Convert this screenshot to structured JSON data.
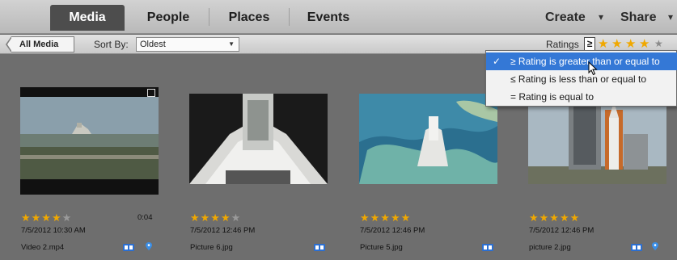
{
  "nav": {
    "tabs": [
      {
        "label": "Media",
        "active": true
      },
      {
        "label": "People",
        "active": false
      },
      {
        "label": "Places",
        "active": false
      },
      {
        "label": "Events",
        "active": false
      }
    ],
    "create_label": "Create",
    "share_label": "Share"
  },
  "toolbar": {
    "all_media_label": "All Media",
    "sort_by_label": "Sort By:",
    "sort_value": "Oldest",
    "ratings_label": "Ratings",
    "rating_operator": "≥",
    "rating_stars_selected": 4,
    "rating_stars_total": 5
  },
  "rating_dropdown": {
    "items": [
      {
        "label": "≥ Rating is greater than or equal to",
        "selected": true
      },
      {
        "label": "≤ Rating is less than or equal to",
        "selected": false
      },
      {
        "label": "= Rating is equal to",
        "selected": false
      }
    ]
  },
  "media": [
    {
      "rating": 4,
      "date": "7/5/2012 10:30 AM",
      "filename": "Video 2.mp4",
      "duration": "0:04",
      "type": "video",
      "has_location": true
    },
    {
      "rating": 4,
      "date": "7/5/2012 12:46 PM",
      "filename": "Picture 6.jpg",
      "type": "photo",
      "has_location": false
    },
    {
      "rating": 5,
      "date": "7/5/2012 12:46 PM",
      "filename": "Picture 5.jpg",
      "type": "photo",
      "has_location": false
    },
    {
      "rating": 5,
      "date": "7/5/2012 12:46 PM",
      "filename": "picture 2.jpg",
      "type": "photo",
      "has_location": true
    }
  ],
  "colors": {
    "accent": "#3478d6",
    "star": "#f0a800",
    "background": "#6e6e6e"
  }
}
